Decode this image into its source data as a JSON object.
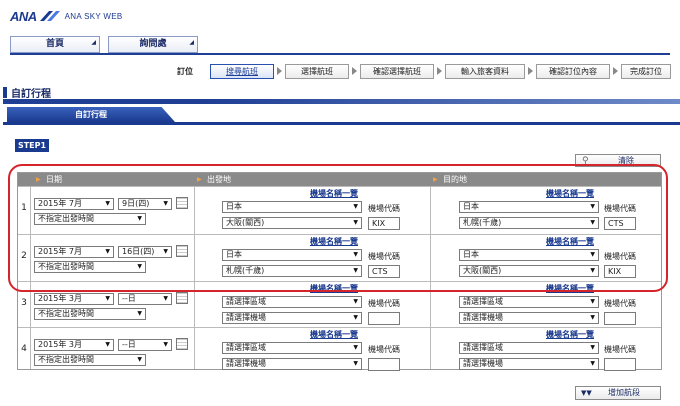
{
  "logo": {
    "brand": "ANA",
    "subtitle": "ANA SKY WEB"
  },
  "topnav": {
    "home": "首頁",
    "inquiry": "詢問處"
  },
  "steps": {
    "label": "訂位",
    "items": [
      "搜尋航班",
      "選擇航班",
      "確認選擇航班",
      "輸入旅客資料",
      "確認訂位內容",
      "完成訂位"
    ]
  },
  "section": {
    "title": "自訂行程",
    "tab": "自訂行程",
    "step": "STEP1"
  },
  "buttons": {
    "clear": "清除",
    "add": "增加航段"
  },
  "table": {
    "headers": {
      "date": "日期",
      "origin": "出發地",
      "destination": "目的地"
    },
    "airport_list_link": "機場名稱一覽",
    "airport_code_label": "機場代碼",
    "rows": [
      {
        "num": "1",
        "month": "2015年 7月",
        "day": "9日(四)",
        "time": "不指定出發時間",
        "from_region": "日本",
        "from_airport": "大阪(關西)",
        "from_code": "KIX",
        "to_region": "日本",
        "to_airport": "札幌(千歲)",
        "to_code": "CTS"
      },
      {
        "num": "2",
        "month": "2015年 7月",
        "day": "16日(四)",
        "time": "不指定出發時間",
        "from_region": "日本",
        "from_airport": "札幌(千歲)",
        "from_code": "CTS",
        "to_region": "日本",
        "to_airport": "大阪(關西)",
        "to_code": "KIX"
      },
      {
        "num": "3",
        "month": "2015年 3月",
        "day": "--日",
        "time": "不指定出發時間",
        "from_region": "請選擇區域",
        "from_airport": "請選擇機場",
        "from_code": "",
        "to_region": "請選擇區域",
        "to_airport": "請選擇機場",
        "to_code": ""
      },
      {
        "num": "4",
        "month": "2015年 3月",
        "day": "--日",
        "time": "不指定出發時間",
        "from_region": "請選擇區域",
        "from_airport": "請選擇機場",
        "from_code": "",
        "to_region": "請選擇區域",
        "to_airport": "請選擇機場",
        "to_code": ""
      }
    ]
  },
  "colors": {
    "brand_blue": "#1a3a8f",
    "highlight": "#d4242c",
    "header_gray": "#8a8a8a"
  }
}
